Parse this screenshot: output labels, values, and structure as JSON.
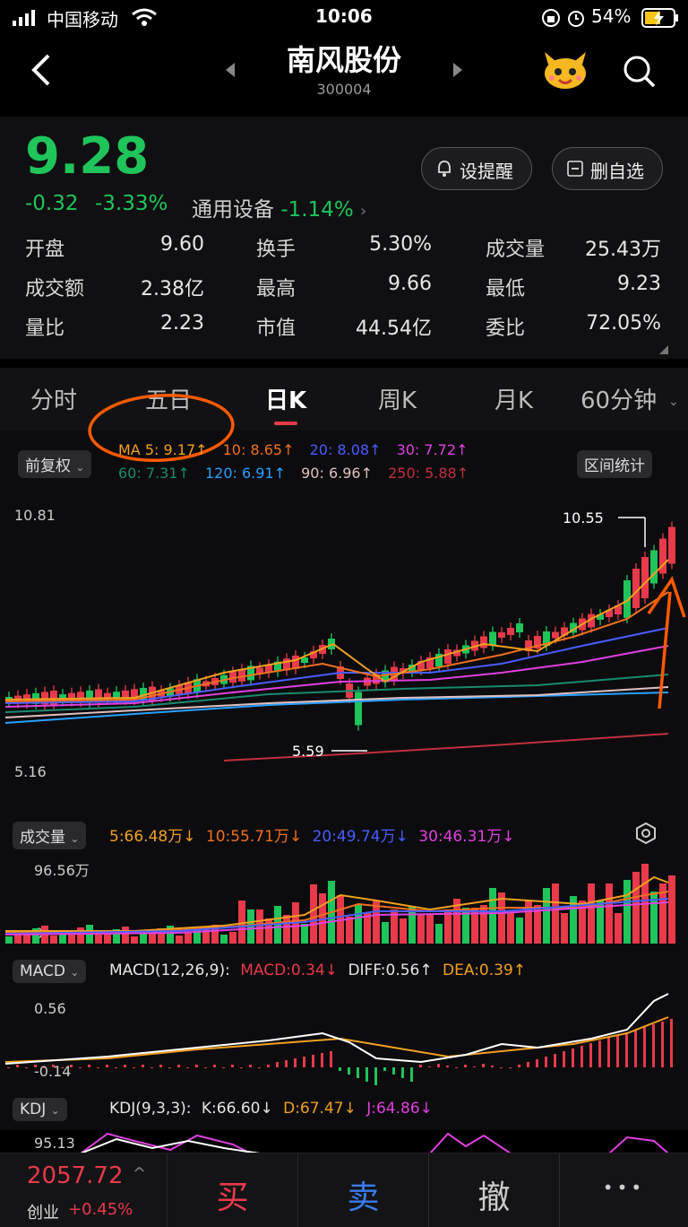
{
  "status": {
    "carrier": "中国移动",
    "time": "10:06",
    "battery": "54%"
  },
  "nav": {
    "title": "南风股份",
    "code": "300004"
  },
  "quote": {
    "price": "9.28",
    "change": "-0.32",
    "change_pct": "-3.33%",
    "sector": "通用设备",
    "sector_pct": "-1.14%",
    "alert_label": "设提醒",
    "remove_label": "删自选",
    "stats": [
      {
        "label": "开盘",
        "value": "9.60",
        "color": "#e8e8e8"
      },
      {
        "label": "换手",
        "value": "5.30%",
        "color": "#e8e8e8"
      },
      {
        "label": "成交量",
        "value": "25.43万",
        "color": "#e8e8e8"
      },
      {
        "label": "成交额",
        "value": "2.38亿",
        "color": "#e8e8e8"
      },
      {
        "label": "最高",
        "value": "9.66",
        "color": "#e83a4a"
      },
      {
        "label": "最低",
        "value": "9.23",
        "color": "#1fc45a"
      },
      {
        "label": "量比",
        "value": "2.23",
        "color": "#e8e8e8"
      },
      {
        "label": "市值",
        "value": "44.54亿",
        "color": "#e8e8e8"
      },
      {
        "label": "委比",
        "value": "72.05%",
        "color": "#e83a4a"
      }
    ]
  },
  "tabs": [
    {
      "label": "分时"
    },
    {
      "label": "五日"
    },
    {
      "label": "日K"
    },
    {
      "label": "周K"
    },
    {
      "label": "月K"
    },
    {
      "label": "60分钟"
    }
  ],
  "kline": {
    "adjust_label": "前复权",
    "range_label": "区间统计",
    "ma_row1": [
      {
        "text": "MA 5: 9.17↑",
        "color": "#f0a020"
      },
      {
        "text": "10: 8.65↑",
        "color": "#f07020"
      },
      {
        "text": "20: 8.08↑",
        "color": "#4a5cff"
      },
      {
        "text": "30: 7.72↑",
        "color": "#e040e0"
      }
    ],
    "ma_row2": [
      {
        "text": "60: 7.31↑",
        "color": "#1a8a70"
      },
      {
        "text": "120: 6.91↑",
        "color": "#2aa0ff"
      },
      {
        "text": "90: 6.96↑",
        "color": "#e0c0c0"
      },
      {
        "text": "250: 5.88↑",
        "color": "#c03040"
      }
    ],
    "y_top": "10.81",
    "y_bottom": "5.16",
    "high_label": "10.55",
    "low_label": "5.59"
  },
  "volume": {
    "label": "成交量",
    "items": [
      {
        "text": "5:66.48万↓",
        "color": "#f0a020"
      },
      {
        "text": "10:55.71万↓",
        "color": "#f07020"
      },
      {
        "text": "20:49.74万↓",
        "color": "#4a5cff"
      },
      {
        "text": "30:46.31万↓",
        "color": "#e040e0"
      }
    ],
    "y_top": "96.56万",
    "y_bottom": "0"
  },
  "macd": {
    "label": "MACD",
    "items": [
      {
        "text": "MACD(12,26,9):",
        "color": "#e6e6e6"
      },
      {
        "text": "MACD:0.34↓",
        "color": "#e83a4a"
      },
      {
        "text": "DIFF:0.56↑",
        "color": "#e6e6e6"
      },
      {
        "text": "DEA:0.39↑",
        "color": "#f0a020"
      }
    ],
    "y_top": "0.56",
    "y_bottom": "-0.14"
  },
  "kdj": {
    "label": "KDJ",
    "items": [
      {
        "text": "KDJ(9,3,3):",
        "color": "#e6e6e6"
      },
      {
        "text": "K:66.60↓",
        "color": "#e6e6e6"
      },
      {
        "text": "D:67.47↓",
        "color": "#f0a020"
      },
      {
        "text": "J:64.86↓",
        "color": "#e040e0"
      }
    ],
    "y_top": "95.13"
  },
  "bottom": {
    "index_value": "2057.72",
    "index_name": "创业",
    "index_pct": "+0.45%",
    "buy": "买",
    "sell": "卖",
    "cancel": "撤",
    "more": "•••"
  },
  "colors": {
    "up": "#e83a4a",
    "down": "#1fc45a",
    "accent": "#ff5a00"
  }
}
